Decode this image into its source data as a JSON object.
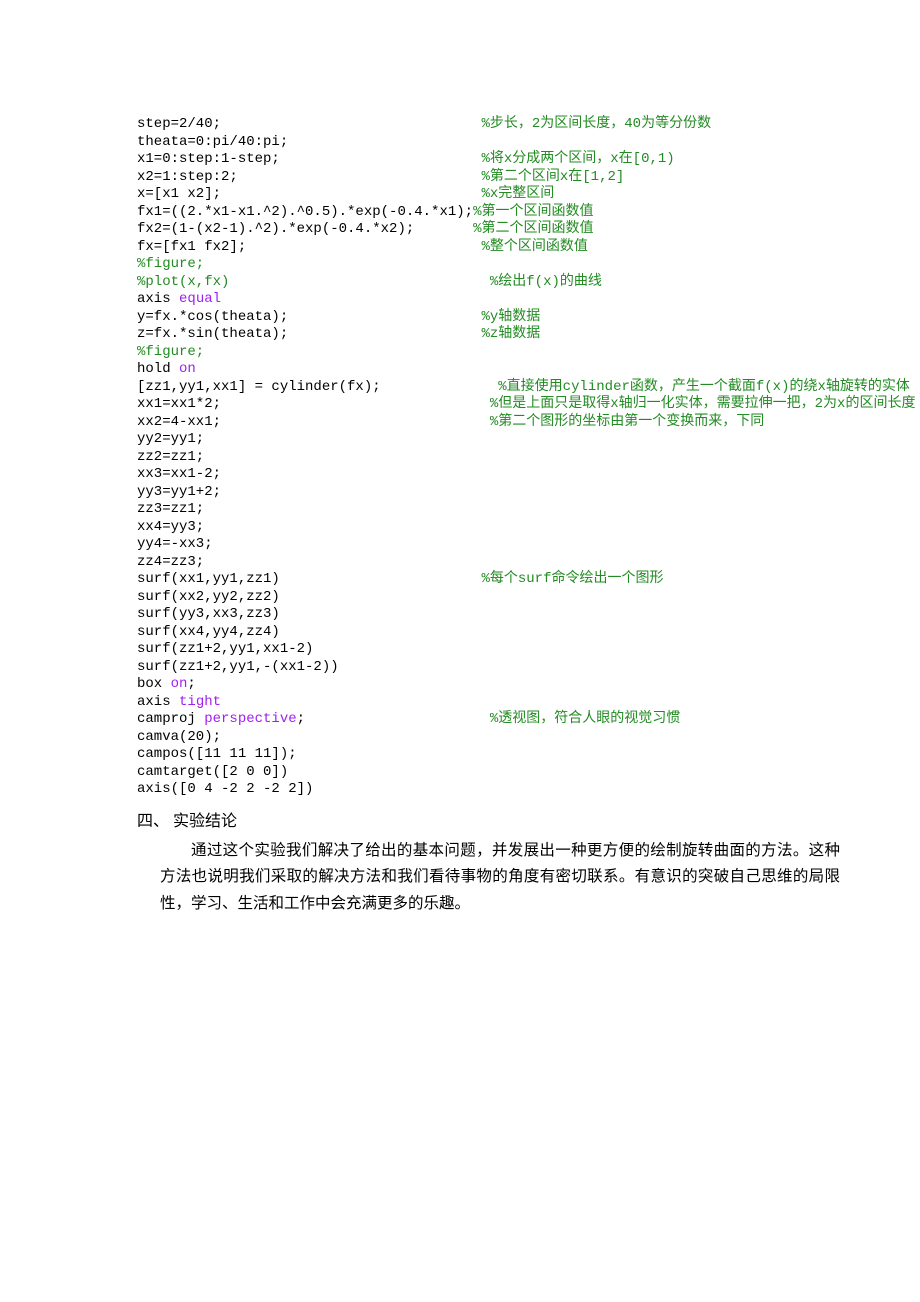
{
  "code": [
    {
      "segs": [
        {
          "t": "step=2/40;",
          "c": "c-black"
        },
        {
          "t": "                               ",
          "c": "c-black"
        },
        {
          "t": "%步长，2为区间长度，40为等分份数",
          "c": "c-green"
        }
      ]
    },
    {
      "segs": [
        {
          "t": "theata=0:pi/40:pi;",
          "c": "c-black"
        }
      ]
    },
    {
      "segs": [
        {
          "t": "x1=0:step:1-step;",
          "c": "c-black"
        },
        {
          "t": "                        ",
          "c": "c-black"
        },
        {
          "t": "%将x分成两个区间，x在[0,1)",
          "c": "c-green"
        }
      ]
    },
    {
      "segs": [
        {
          "t": "x2=1:step:2;",
          "c": "c-black"
        },
        {
          "t": "                             ",
          "c": "c-black"
        },
        {
          "t": "%第二个区间x在[1,2]",
          "c": "c-green"
        }
      ]
    },
    {
      "segs": [
        {
          "t": "x=[x1 x2];",
          "c": "c-black"
        },
        {
          "t": "                               ",
          "c": "c-black"
        },
        {
          "t": "%x完整区间",
          "c": "c-green"
        }
      ]
    },
    {
      "segs": [
        {
          "t": "fx1=((2.*x1-x1.^2).^0.5).*exp(-0.4.*x1);",
          "c": "c-black"
        },
        {
          "t": "%第一个区间函数值",
          "c": "c-green"
        }
      ]
    },
    {
      "segs": [
        {
          "t": "fx2=(1-(x2-1).^2).*exp(-0.4.*x2);",
          "c": "c-black"
        },
        {
          "t": "       ",
          "c": "c-black"
        },
        {
          "t": "%第二个区间函数值",
          "c": "c-green"
        }
      ]
    },
    {
      "segs": [
        {
          "t": "fx=[fx1 fx2];",
          "c": "c-black"
        },
        {
          "t": "                            ",
          "c": "c-black"
        },
        {
          "t": "%整个区间函数值",
          "c": "c-green"
        }
      ]
    },
    {
      "segs": [
        {
          "t": "%figure;",
          "c": "c-green"
        }
      ]
    },
    {
      "segs": [
        {
          "t": "%plot(x,fx)",
          "c": "c-green"
        },
        {
          "t": "                               ",
          "c": "c-black"
        },
        {
          "t": "%绘出f(x)的曲线",
          "c": "c-green"
        }
      ]
    },
    {
      "segs": [
        {
          "t": "axis ",
          "c": "c-black"
        },
        {
          "t": "equal",
          "c": "c-purple"
        }
      ]
    },
    {
      "segs": [
        {
          "t": "y=fx.*cos(theata);",
          "c": "c-black"
        },
        {
          "t": "                       ",
          "c": "c-black"
        },
        {
          "t": "%y轴数据",
          "c": "c-green"
        }
      ]
    },
    {
      "segs": [
        {
          "t": "z=fx.*sin(theata);",
          "c": "c-black"
        },
        {
          "t": "                       ",
          "c": "c-black"
        },
        {
          "t": "%z轴数据",
          "c": "c-green"
        }
      ]
    },
    {
      "segs": [
        {
          "t": "%figure;",
          "c": "c-green"
        }
      ]
    },
    {
      "segs": [
        {
          "t": "hold ",
          "c": "c-black"
        },
        {
          "t": "on",
          "c": "c-purple"
        }
      ]
    },
    {
      "segs": [
        {
          "t": "[zz1,yy1,xx1] = cylinder(fx);",
          "c": "c-black"
        },
        {
          "t": "              ",
          "c": "c-black"
        },
        {
          "t": "%直接使用cylinder函数，产生一个截面f(x)的绕x轴旋转的实体",
          "c": "c-green"
        }
      ]
    },
    {
      "segs": [
        {
          "t": "xx1=xx1*2;",
          "c": "c-black"
        },
        {
          "t": "                                ",
          "c": "c-black"
        },
        {
          "t": "%但是上面只是取得x轴归一化实体，需要拉伸一把，2为x的区间长度",
          "c": "c-green"
        }
      ]
    },
    {
      "segs": [
        {
          "t": "xx2=4-xx1;",
          "c": "c-black"
        },
        {
          "t": "                                ",
          "c": "c-black"
        },
        {
          "t": "%第二个图形的坐标由第一个变换而来，下同",
          "c": "c-green"
        }
      ]
    },
    {
      "segs": [
        {
          "t": "yy2=yy1;",
          "c": "c-black"
        }
      ]
    },
    {
      "segs": [
        {
          "t": "zz2=zz1;",
          "c": "c-black"
        }
      ]
    },
    {
      "segs": [
        {
          "t": "xx3=xx1-2;",
          "c": "c-black"
        }
      ]
    },
    {
      "segs": [
        {
          "t": "yy3=yy1+2;",
          "c": "c-black"
        }
      ]
    },
    {
      "segs": [
        {
          "t": "zz3=zz1;",
          "c": "c-black"
        }
      ]
    },
    {
      "segs": [
        {
          "t": "xx4=yy3;",
          "c": "c-black"
        }
      ]
    },
    {
      "segs": [
        {
          "t": "yy4=-xx3;",
          "c": "c-black"
        }
      ]
    },
    {
      "segs": [
        {
          "t": "zz4=zz3;",
          "c": "c-black"
        }
      ]
    },
    {
      "segs": [
        {
          "t": "surf(xx1,yy1,zz1)",
          "c": "c-black"
        },
        {
          "t": "                        ",
          "c": "c-black"
        },
        {
          "t": "%每个surf命令绘出一个图形",
          "c": "c-green"
        }
      ]
    },
    {
      "segs": [
        {
          "t": "surf(xx2,yy2,zz2)",
          "c": "c-black"
        }
      ]
    },
    {
      "segs": [
        {
          "t": "surf(yy3,xx3,zz3)",
          "c": "c-black"
        }
      ]
    },
    {
      "segs": [
        {
          "t": "surf(xx4,yy4,zz4)",
          "c": "c-black"
        }
      ]
    },
    {
      "segs": [
        {
          "t": "surf(zz1+2,yy1,xx1-2)",
          "c": "c-black"
        }
      ]
    },
    {
      "segs": [
        {
          "t": "surf(zz1+2,yy1,-(xx1-2))",
          "c": "c-black"
        }
      ]
    },
    {
      "segs": [
        {
          "t": "box ",
          "c": "c-black"
        },
        {
          "t": "on",
          "c": "c-purple"
        },
        {
          "t": ";",
          "c": "c-black"
        }
      ]
    },
    {
      "segs": [
        {
          "t": "axis ",
          "c": "c-black"
        },
        {
          "t": "tight",
          "c": "c-purple"
        }
      ]
    },
    {
      "segs": [
        {
          "t": "camproj ",
          "c": "c-black"
        },
        {
          "t": "perspective",
          "c": "c-purple"
        },
        {
          "t": ";",
          "c": "c-black"
        },
        {
          "t": "                      ",
          "c": "c-black"
        },
        {
          "t": "%透视图，符合人眼的视觉习惯",
          "c": "c-green"
        }
      ]
    },
    {
      "segs": [
        {
          "t": "camva(20);",
          "c": "c-black"
        }
      ]
    },
    {
      "segs": [
        {
          "t": "campos([11 11 11]);",
          "c": "c-black"
        }
      ]
    },
    {
      "segs": [
        {
          "t": "camtarget([2 0 0])",
          "c": "c-black"
        }
      ]
    },
    {
      "segs": [
        {
          "t": "axis([0 4 -2 2 -2 2])",
          "c": "c-black"
        }
      ]
    }
  ],
  "section": {
    "heading": "四、 实验结论",
    "body": "通过这个实验我们解决了给出的基本问题，并发展出一种更方便的绘制旋转曲面的方法。这种方法也说明我们采取的解决方法和我们看待事物的角度有密切联系。有意识的突破自己思维的局限性，学习、生活和工作中会充满更多的乐趣。"
  }
}
